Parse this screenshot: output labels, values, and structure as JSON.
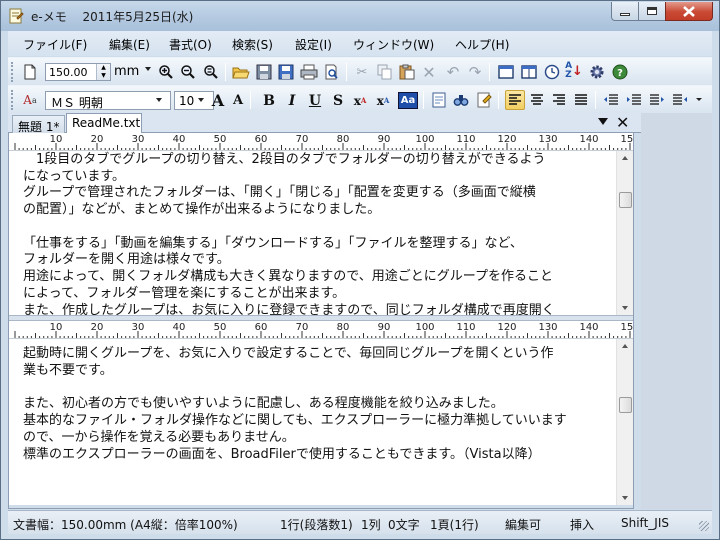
{
  "window": {
    "title": "e-メモ　 2011年5月25日(水)",
    "controls": {
      "minimize_icon": "minimize-icon",
      "maximize_icon": "maximize-icon",
      "close_icon": "close-icon"
    }
  },
  "menu": {
    "items": [
      "ファイル(F)",
      "編集(E)",
      "書式(O)",
      "検索(S)",
      "設定(I)",
      "ウィンドウ(W)",
      "ヘルプ(H)"
    ]
  },
  "toolbar1": {
    "width_value": "150.00",
    "unit": "mm",
    "icons": [
      "page-icon",
      "zoom-in-icon",
      "zoom-out-icon",
      "zoom-reset-icon",
      "open-folder-icon",
      "save-icon",
      "save-as-icon",
      "print-icon",
      "print-preview-icon",
      "cut-icon",
      "copy-icon",
      "paste-icon",
      "delete-icon",
      "undo-icon",
      "redo-icon",
      "single-pane-icon",
      "split-pane-icon",
      "clock-icon",
      "sort-az-icon",
      "settings-icon",
      "help-icon"
    ]
  },
  "toolbar2": {
    "font_name": "ＭＳ 明朝",
    "font_size": "10",
    "buttons": {
      "grow": "A",
      "shrink": "A",
      "bold": "B",
      "italic": "I",
      "underline": "U",
      "strike": "S",
      "superscript": "x",
      "subscript": "x",
      "highlight": "Aa"
    }
  },
  "tabs": [
    {
      "label": "無題 1*",
      "active": false
    },
    {
      "label": "ReadMe.txt",
      "active": true
    }
  ],
  "ruler": {
    "labels": [
      "10",
      "20",
      "30",
      "40",
      "50",
      "60",
      "70",
      "80",
      "90",
      "100",
      "110",
      "120",
      "130",
      "140",
      "150"
    ]
  },
  "pane_top": {
    "lines": [
      "　1段目のタブでグループの切り替え、2段目のタブでフォルダーの切り替えができるよう",
      "になっています。",
      "グループで管理されたフォルダーは、「開く」「閉じる」「配置を変更する（多画面で縦横",
      "の配置）」などが、まとめて操作が出来るようになりました。",
      "",
      "「仕事をする」「動画を編集する」「ダウンロードする」「ファイルを整理する」など、",
      "フォルダーを開く用途は様々です。",
      "用途によって、開くフォルダ構成も大きく異なりますので、用途ごとにグループを作ること",
      "によって、フォルダー管理を楽にすることが出来ます。",
      "また、作成したグループは、お気に入りに登録できますので、同じフォルダ構成で再度開く"
    ]
  },
  "pane_bottom": {
    "lines": [
      "起動時に開くグループを、お気に入りで設定することで、毎回同じグループを開くという作",
      "業も不要です。",
      "",
      "また、初心者の方でも使いやすいように配慮し、ある程度機能を絞り込みました。",
      "基本的なファイル・フォルダ操作などに関しても、エクスプローラーに極力準拠していいます",
      "ので、一から操作を覚える必要もありません。",
      "標準のエクスプローラーの画面を、BroadFilerで使用することもできます。（Vista以降）"
    ]
  },
  "status": {
    "width_info": "文書幅：150.00mm (A4縦：倍率100%)",
    "position": "1行(段落数1)",
    "column": "1列",
    "chars": "0文字",
    "page": "1頁(1行)",
    "mode": "編集可",
    "insert": "挿入",
    "encoding": "Shift_JIS"
  }
}
